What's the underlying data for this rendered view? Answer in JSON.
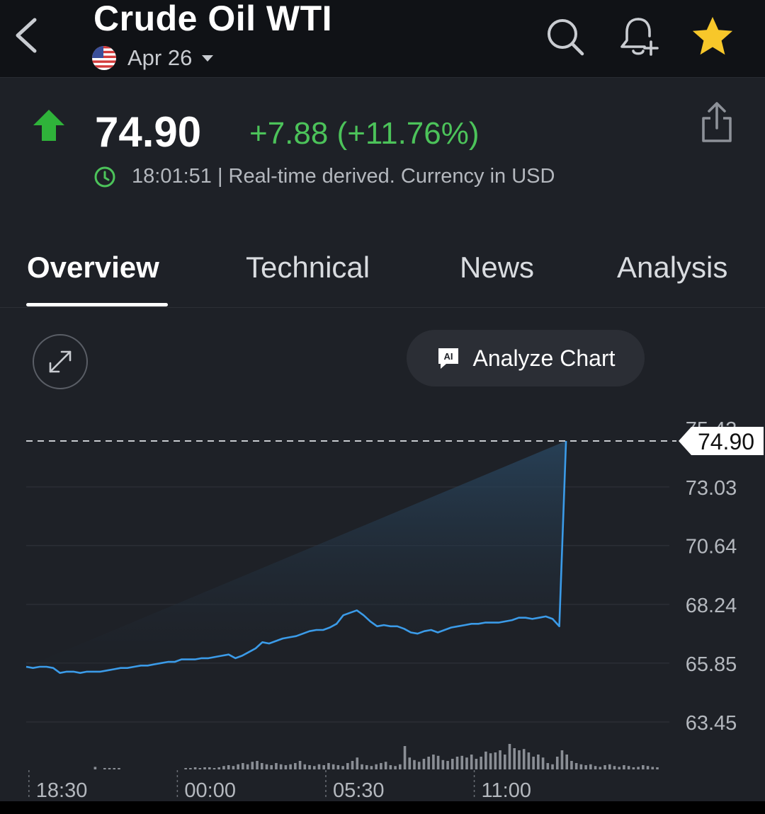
{
  "header": {
    "title": "Crude Oil WTI",
    "date": "Apr 26",
    "icons": [
      "back-chevron-icon",
      "search-icon",
      "add-alert-bell-icon",
      "star-icon"
    ],
    "star_color": "#f7c72a"
  },
  "quote": {
    "price": "74.90",
    "change": "+7.88 (+11.76%)",
    "time": "18:01:51 | Real-time derived. Currency in USD",
    "positive_color": "#4cc35a"
  },
  "tabs": [
    {
      "label": "Overview",
      "active": true
    },
    {
      "label": "Technical",
      "active": false
    },
    {
      "label": "News",
      "active": false
    },
    {
      "label": "Analysis",
      "active": false
    }
  ],
  "chart_controls": {
    "analyze_label": "Analyze Chart",
    "ai_badge": "AI"
  },
  "chart_data": {
    "type": "area",
    "line_color": "#3b9be8",
    "current_value": 74.9,
    "current_label": "74.90",
    "y_ticks": [
      "75.42",
      "73.03",
      "70.64",
      "68.24",
      "65.85",
      "63.45"
    ],
    "y_tick_values": [
      75.42,
      73.03,
      70.64,
      68.24,
      65.85,
      63.45
    ],
    "x_ticks": [
      "18:30",
      "00:00",
      "05:30",
      "11:00"
    ],
    "x_tick_values": [
      0.2,
      11.2,
      22.2,
      33.2
    ],
    "x_range": [
      0,
      47.5
    ],
    "ylim": [
      63.45,
      75.42
    ],
    "x": [
      0,
      0.5,
      1,
      1.5,
      2,
      2.5,
      3,
      3.5,
      4,
      4.5,
      5,
      5.5,
      6,
      6.5,
      7,
      7.5,
      8,
      8.5,
      9,
      9.5,
      10,
      10.5,
      11,
      11.5,
      12,
      12.5,
      13,
      13.5,
      14,
      14.5,
      15,
      15.5,
      16,
      16.5,
      17,
      17.5,
      18,
      18.5,
      19,
      19.5,
      20,
      20.5,
      21,
      21.5,
      22,
      22.5,
      23,
      23.5,
      24,
      24.5,
      25,
      25.5,
      26,
      26.5,
      27,
      27.5,
      28,
      28.5,
      29,
      29.5,
      30,
      30.5,
      31,
      31.5,
      32,
      32.5,
      33,
      33.5,
      34,
      34.5,
      35,
      35.5,
      36,
      36.5,
      37,
      37.5,
      38,
      38.5,
      39,
      39.5,
      40,
      40.5,
      41,
      41.5,
      42,
      42.5,
      43,
      43.5,
      44,
      44.5,
      45,
      45.5,
      46,
      46.5,
      47
    ],
    "y": [
      65.7,
      65.65,
      65.7,
      65.7,
      65.65,
      65.45,
      65.5,
      65.5,
      65.45,
      65.5,
      65.5,
      65.5,
      65.55,
      65.6,
      65.65,
      65.65,
      65.7,
      65.75,
      65.75,
      65.8,
      65.85,
      65.9,
      65.9,
      66.0,
      66.0,
      66.0,
      66.05,
      66.05,
      66.1,
      66.15,
      66.2,
      66.05,
      66.15,
      66.3,
      66.45,
      66.7,
      66.65,
      66.75,
      66.85,
      66.9,
      66.95,
      67.05,
      67.15,
      67.2,
      67.2,
      67.3,
      67.45,
      67.8,
      67.9,
      68.0,
      67.8,
      67.55,
      67.35,
      67.4,
      67.35,
      67.35,
      67.25,
      67.1,
      67.05,
      67.15,
      67.2,
      67.1,
      67.2,
      67.3,
      67.35,
      67.4,
      67.45,
      67.45,
      67.5,
      67.5,
      67.5,
      67.55,
      67.6,
      67.7,
      67.7,
      67.65,
      67.7,
      67.75,
      67.65,
      67.35,
      74.9
    ],
    "volume": [
      0,
      0,
      0,
      0,
      0,
      0,
      0.06,
      0,
      0.03,
      0.03,
      0.03,
      0.03,
      0,
      0,
      0,
      0,
      0,
      0,
      0,
      0,
      0,
      0,
      0,
      0,
      0,
      0.03,
      0.03,
      0.05,
      0.03,
      0.05,
      0.05,
      0.03,
      0.05,
      0.08,
      0.1,
      0.08,
      0.12,
      0.15,
      0.12,
      0.18,
      0.2,
      0.15,
      0.12,
      0.1,
      0.15,
      0.12,
      0.1,
      0.12,
      0.15,
      0.2,
      0.12,
      0.1,
      0.08,
      0.12,
      0.1,
      0.15,
      0.12,
      0.1,
      0.08,
      0.15,
      0.2,
      0.28,
      0.12,
      0.1,
      0.08,
      0.12,
      0.15,
      0.18,
      0.1,
      0.08,
      0.12,
      0.55,
      0.28,
      0.22,
      0.18,
      0.25,
      0.3,
      0.35,
      0.32,
      0.22,
      0.2,
      0.25,
      0.3,
      0.32,
      0.28,
      0.35,
      0.25,
      0.3,
      0.42,
      0.38,
      0.4,
      0.45,
      0.35,
      0.6,
      0.5,
      0.45,
      0.48,
      0.4,
      0.3,
      0.35,
      0.28,
      0.15,
      0.12,
      0.3,
      0.45,
      0.35,
      0.2,
      0.15,
      0.12,
      0.1,
      0.12,
      0.08,
      0.06,
      0.1,
      0.12,
      0.08,
      0.06,
      0.1,
      0.08,
      0.05,
      0.06,
      0.1,
      0.08,
      0.06,
      0.05
    ],
    "grid": true
  }
}
